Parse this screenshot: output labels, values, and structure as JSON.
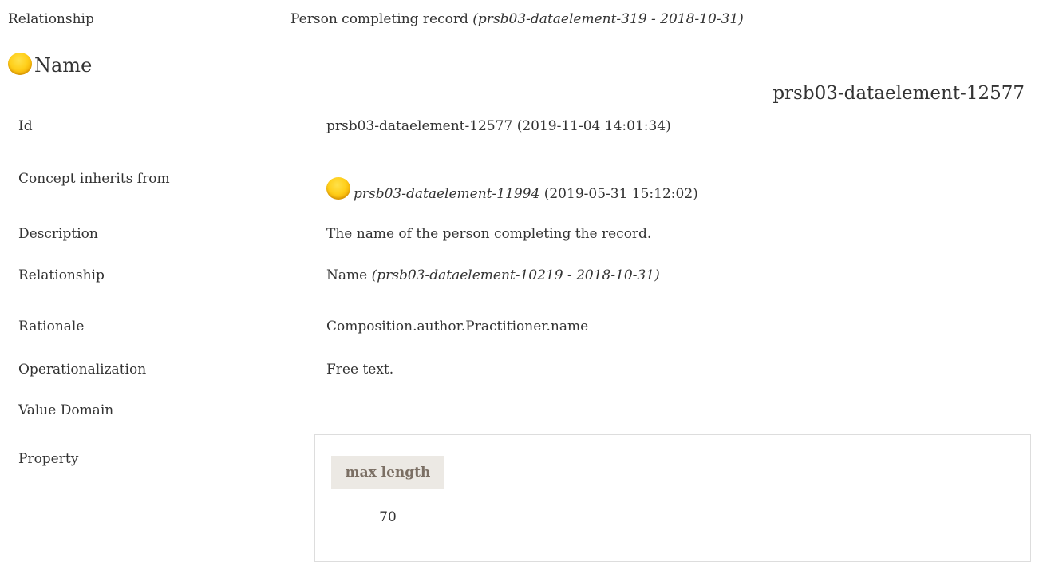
{
  "parent": {
    "relationship_label": "Relationship",
    "relationship_value": "Person completing record",
    "relationship_ref": "(prsb03-dataelement-319 - 2018-10-31)"
  },
  "concept": {
    "title": "Name",
    "icon": "concept-orb-icon",
    "id_header": "prsb03-dataelement-12577",
    "fields": {
      "id": {
        "label": "Id",
        "value": "prsb03-dataelement-12577 (2019-11-04 14:01:34)"
      },
      "inherits": {
        "label": "Concept inherits from",
        "ref": "prsb03-dataelement-11994",
        "date": "(2019-05-31 15:12:02)"
      },
      "description": {
        "label": "Description",
        "value": "The name of the person completing the record."
      },
      "relationship": {
        "label": "Relationship",
        "value": "Name",
        "ref": "(prsb03-dataelement-10219 - 2018-10-31)"
      },
      "rationale": {
        "label": "Rationale",
        "value": "Composition.author.Practitioner.name"
      },
      "operationalization": {
        "label": "Operationalization",
        "value": "Free text."
      },
      "value_domain": {
        "label": "Value Domain",
        "value": ""
      },
      "property": {
        "label": "Property",
        "column_header": "max length",
        "column_value": "70"
      }
    }
  },
  "colors": {
    "orb": "#ffcf1a",
    "property_header_bg": "#ece9e4",
    "property_header_text": "#7b6f64",
    "border": "#dddddd"
  }
}
